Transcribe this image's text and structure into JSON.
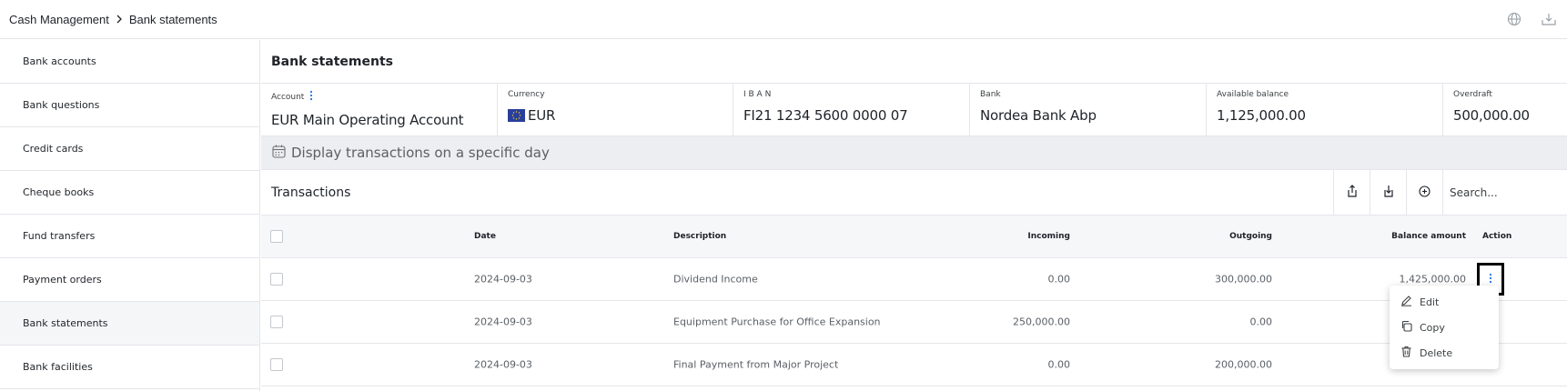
{
  "breadcrumb": {
    "root": "Cash Management",
    "current": "Bank statements"
  },
  "top_actions": [
    "globe-icon",
    "download-tray-icon"
  ],
  "sidebar": {
    "items": [
      {
        "label": "Bank accounts"
      },
      {
        "label": "Bank questions"
      },
      {
        "label": "Credit cards"
      },
      {
        "label": "Cheque books"
      },
      {
        "label": "Fund transfers"
      },
      {
        "label": "Payment orders"
      },
      {
        "label": "Bank statements",
        "active": true
      },
      {
        "label": "Bank facilities"
      }
    ]
  },
  "main": {
    "title": "Bank statements",
    "info": {
      "account_label": "Account",
      "account_value": "EUR Main Operating Account",
      "currency_label": "Currency",
      "currency_value": "EUR",
      "iban_label": "I B A N",
      "iban_value": "FI21 1234 5600 0000 07",
      "bank_label": "Bank",
      "bank_value": "Nordea Bank Abp",
      "available_label": "Available balance",
      "available_value": "1,125,000.00",
      "overdraft_label": "Overdraft",
      "overdraft_value": "500,000.00"
    },
    "day_filter": "Display transactions on a specific day",
    "transactions": {
      "title": "Transactions",
      "search_placeholder": "Search...",
      "columns": {
        "date": "Date",
        "description": "Description",
        "incoming": "Incoming",
        "outgoing": "Outgoing",
        "balance": "Balance amount",
        "action": "Action"
      },
      "rows": [
        {
          "date": "2024-09-03",
          "description": "Dividend Income",
          "incoming": "0.00",
          "outgoing": "300,000.00",
          "balance": "1,425,000.00"
        },
        {
          "date": "2024-09-03",
          "description": "Equipment Purchase for Office Expansion",
          "incoming": "250,000.00",
          "outgoing": "0.00",
          "balance": ""
        },
        {
          "date": "2024-09-03",
          "description": "Final Payment from Major Project",
          "incoming": "0.00",
          "outgoing": "200,000.00",
          "balance": ""
        }
      ]
    },
    "context_menu": {
      "edit": "Edit",
      "copy": "Copy",
      "delete": "Delete"
    }
  },
  "colors": {
    "accent": "#1a73e8",
    "border": "#e4e6ea",
    "eu_flag": "#2a3e9a"
  }
}
